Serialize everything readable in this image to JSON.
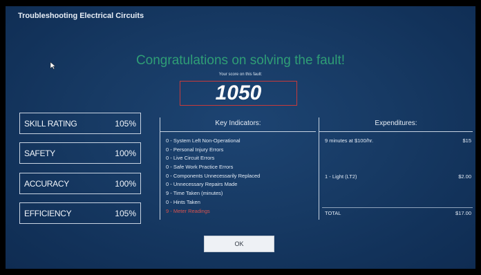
{
  "app": {
    "title": "Troubleshooting Electrical Circuits"
  },
  "result": {
    "headline": "Congratulations on solving the fault!",
    "score_caption": "Your score on this fault:",
    "score": "1050"
  },
  "stats": [
    {
      "label": "SKILL RATING",
      "value": "105%"
    },
    {
      "label": "SAFETY",
      "value": "100%"
    },
    {
      "label": "ACCURACY",
      "value": "100%"
    },
    {
      "label": "EFFICIENCY",
      "value": "105%"
    }
  ],
  "key_indicators": {
    "header": "Key Indicators:",
    "items": [
      "0 - System Left Non-Operational",
      "0 - Personal Injury Errors",
      "0 - Live Circuit Errors",
      "0 - Safe Work Practice Errors",
      "0 - Components Unnecessarily Replaced",
      "0 - Unnecessary Repairs Made",
      "9 - Time Taken (minutes)",
      "0 - Hints Taken",
      "9 - Meter Readings"
    ]
  },
  "expenditures": {
    "header": "Expenditures:",
    "rows": [
      {
        "label": "9 minutes at $100/hr.",
        "amount": "$15"
      },
      {
        "label": "1 - Light (LT2)",
        "amount": "$2.00"
      }
    ],
    "total_label": "TOTAL",
    "total_amount": "$17.00"
  },
  "ok_button": {
    "label": "OK"
  },
  "colors": {
    "headline": "#2f9e76",
    "score_border": "#c83a3a",
    "warning_text": "#d9534f",
    "background": "#173a64"
  },
  "icons": {
    "cursor": "mouse-pointer-icon"
  }
}
